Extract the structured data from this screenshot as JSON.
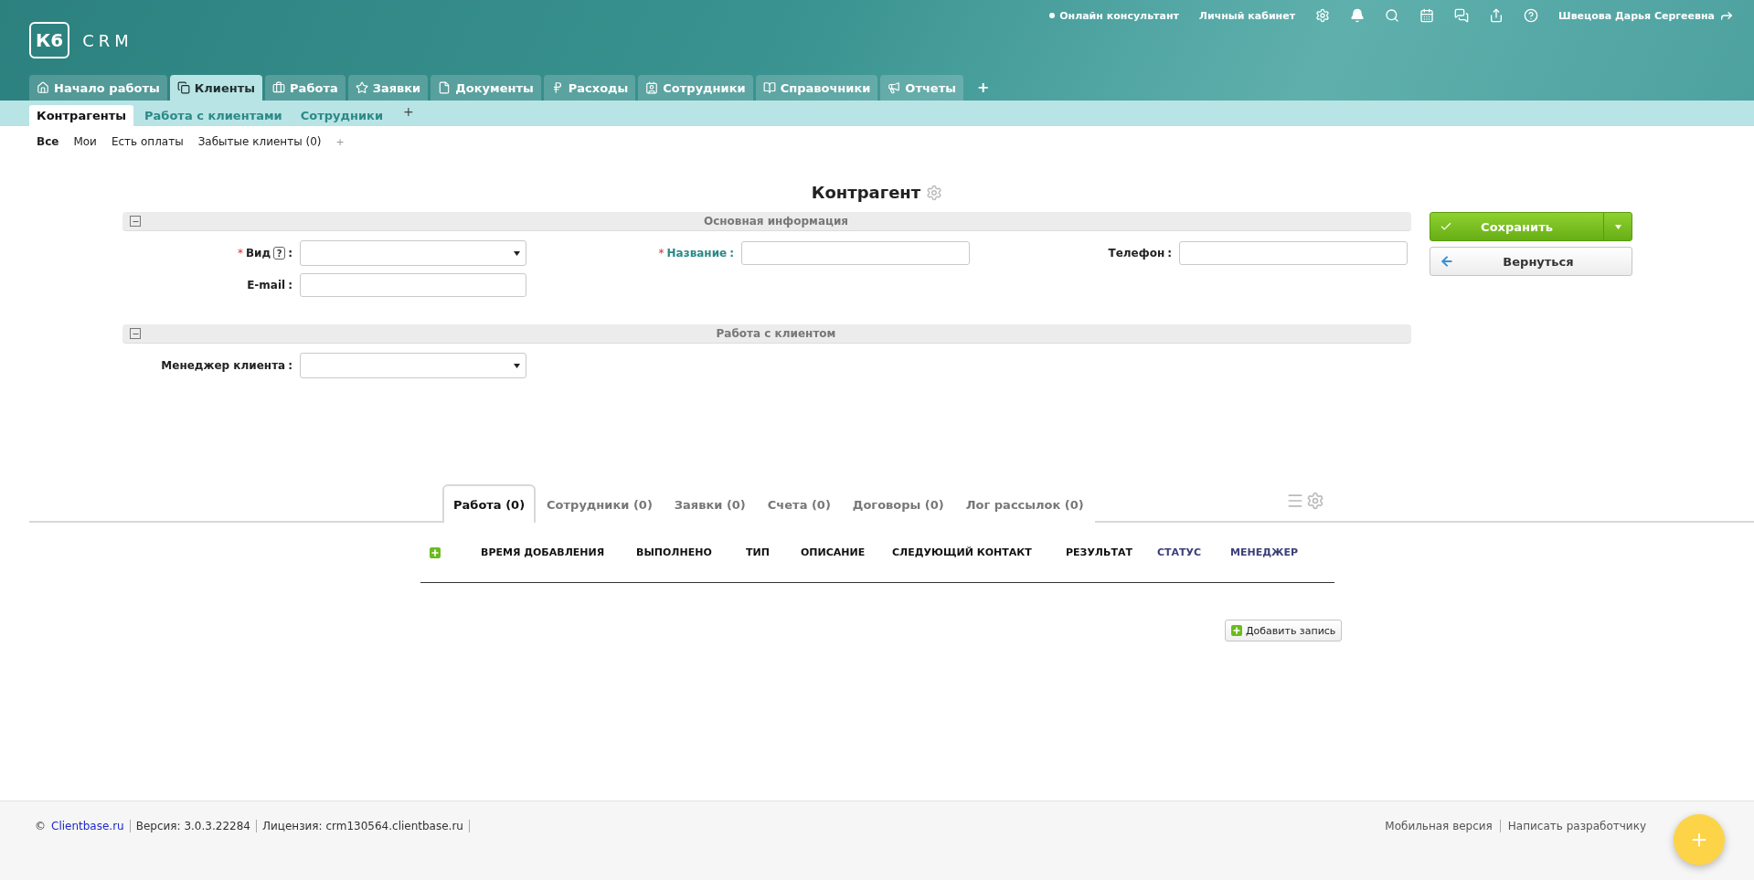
{
  "header": {
    "logo": {
      "badge": "К6",
      "text": "CRM"
    },
    "top_links": [
      {
        "kind": "status",
        "label": "Онлайн консультант"
      },
      {
        "kind": "link",
        "label": "Личный кабинет"
      }
    ],
    "user": "Швецова Дарья Сергеевна"
  },
  "nav_tabs": [
    {
      "label": "Начало работы",
      "selected": false
    },
    {
      "label": "Клиенты",
      "selected": true
    },
    {
      "label": "Работа",
      "selected": false
    },
    {
      "label": "Заявки",
      "selected": false
    },
    {
      "label": "Документы",
      "selected": false
    },
    {
      "label": "Расходы",
      "selected": false
    },
    {
      "label": "Сотрудники",
      "selected": false
    },
    {
      "label": "Справочники",
      "selected": false
    },
    {
      "label": "Отчеты",
      "selected": false
    }
  ],
  "nav_add": "+",
  "sub_tabs": [
    {
      "label": "Контрагенты",
      "selected": true
    },
    {
      "label": "Работа с клиентами",
      "selected": false
    },
    {
      "label": "Сотрудники",
      "selected": false
    }
  ],
  "sub_add": "+",
  "filters": [
    {
      "label": "Все",
      "selected": true
    },
    {
      "label": "Мои",
      "selected": false
    },
    {
      "label": "Есть оплаты",
      "selected": false
    },
    {
      "label": "Забытые клиенты (0)",
      "selected": false
    }
  ],
  "filter_add": "+",
  "page_title": "Контрагент",
  "sections": [
    {
      "title": "Основная информация",
      "expanded": true,
      "fields": [
        {
          "label": "Вид",
          "marker": "*",
          "help": "?",
          "suffix": ":",
          "kind": "select",
          "linked": false
        },
        {
          "label": "Название",
          "marker": "*",
          "suffix": ":",
          "kind": "text",
          "linked": true
        },
        {
          "label": "Телефон",
          "suffix": ":",
          "kind": "text",
          "linked": false
        },
        {
          "label": "E-mail",
          "suffix": ":",
          "kind": "text",
          "linked": false
        }
      ]
    },
    {
      "title": "Работа с клиентом",
      "expanded": true,
      "fields": [
        {
          "label": "Менеджер клиента",
          "suffix": ":",
          "kind": "select",
          "linked": false
        }
      ]
    }
  ],
  "actions": {
    "save": {
      "label": "Сохранить",
      "has_menu": true
    },
    "back": {
      "label": "Вернуться"
    }
  },
  "detail_tabs": [
    {
      "label": "Работа (0)",
      "selected": true
    },
    {
      "label": "Сотрудники (0)",
      "selected": false
    },
    {
      "label": "Заявки (0)",
      "selected": false
    },
    {
      "label": "Счета (0)",
      "selected": false
    },
    {
      "label": "Договоры (0)",
      "selected": false
    },
    {
      "label": "Лог рассылок (0)",
      "selected": false
    }
  ],
  "table": {
    "columns": [
      {
        "label": "ВРЕМЯ ДОБАВЛЕНИЯ",
        "linked": false
      },
      {
        "label": "ВЫПОЛНЕНО",
        "linked": false
      },
      {
        "label": "ТИП",
        "linked": false
      },
      {
        "label": "ОПИСАНИЕ",
        "linked": false
      },
      {
        "label": "СЛЕДУЮЩИЙ КОНТАКТ",
        "linked": false
      },
      {
        "label": "РЕЗУЛЬТАТ",
        "linked": false
      },
      {
        "label": "СТАТУС",
        "linked": true
      },
      {
        "label": "МЕНЕДЖЕР",
        "linked": true
      }
    ],
    "add_record": "Добавить запись"
  },
  "footer": {
    "copyright": "©",
    "site_link": "Clientbase.ru",
    "items": [
      "Версия: 3.0.3.22284",
      "Лицензия: crm130564.clientbase.ru"
    ],
    "links": [
      "Мобильная версия",
      "Написать разработчику"
    ]
  }
}
